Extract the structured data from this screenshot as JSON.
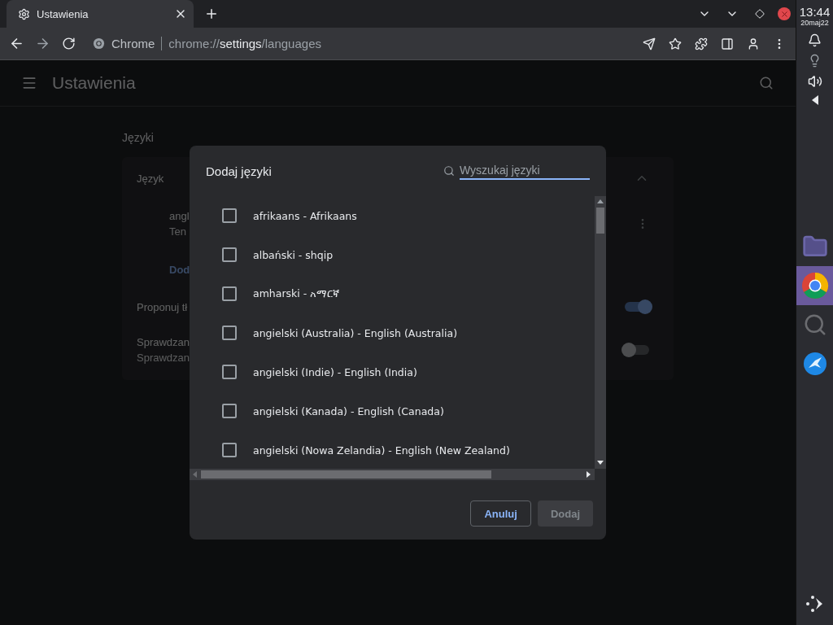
{
  "browser": {
    "tabs": [
      {
        "title": "Ustawienia",
        "selected": true
      }
    ],
    "address": {
      "site_label": "Chrome",
      "url_scheme": "chrome://",
      "url_host": "settings",
      "url_path": "/languages"
    }
  },
  "settings": {
    "title": "Ustawienia",
    "section_title": "Języki",
    "rows": [
      {
        "kind": "header",
        "label": "Język",
        "expanded": true
      },
      {
        "kind": "language",
        "label": "angl",
        "sublabel": "Ten"
      },
      {
        "kind": "link",
        "label": "Dod"
      },
      {
        "kind": "toggle",
        "label": "Proponuj tł",
        "on": true
      },
      {
        "kind": "toggle",
        "label": "Sprawdzan",
        "sublabel": "Sprawdzan",
        "on": false
      }
    ]
  },
  "dialog": {
    "title": "Dodaj języki",
    "search_placeholder": "Wyszukaj języki",
    "languages": [
      {
        "label": "afrikaans - Afrikaans",
        "checked": false
      },
      {
        "label": "albański - shqip",
        "checked": false
      },
      {
        "label": "amharski - አማርኛ",
        "checked": false
      },
      {
        "label": "angielski (Australia) - English (Australia)",
        "checked": false
      },
      {
        "label": "angielski (Indie) - English (India)",
        "checked": false
      },
      {
        "label": "angielski (Kanada) - English (Canada)",
        "checked": false
      },
      {
        "label": "angielski (Nowa Zelandia) - English (New Zealand)",
        "checked": false
      }
    ],
    "buttons": [
      {
        "label": "Anuluj",
        "disabled": false
      },
      {
        "label": "Dodaj",
        "disabled": true
      }
    ]
  },
  "shelf": {
    "time": "13:44",
    "date": "20maj22",
    "apps": [
      {
        "kind": "files",
        "selected": false
      },
      {
        "kind": "chrome",
        "selected": true
      },
      {
        "kind": "search",
        "selected": false
      },
      {
        "kind": "bird",
        "selected": false
      }
    ]
  }
}
